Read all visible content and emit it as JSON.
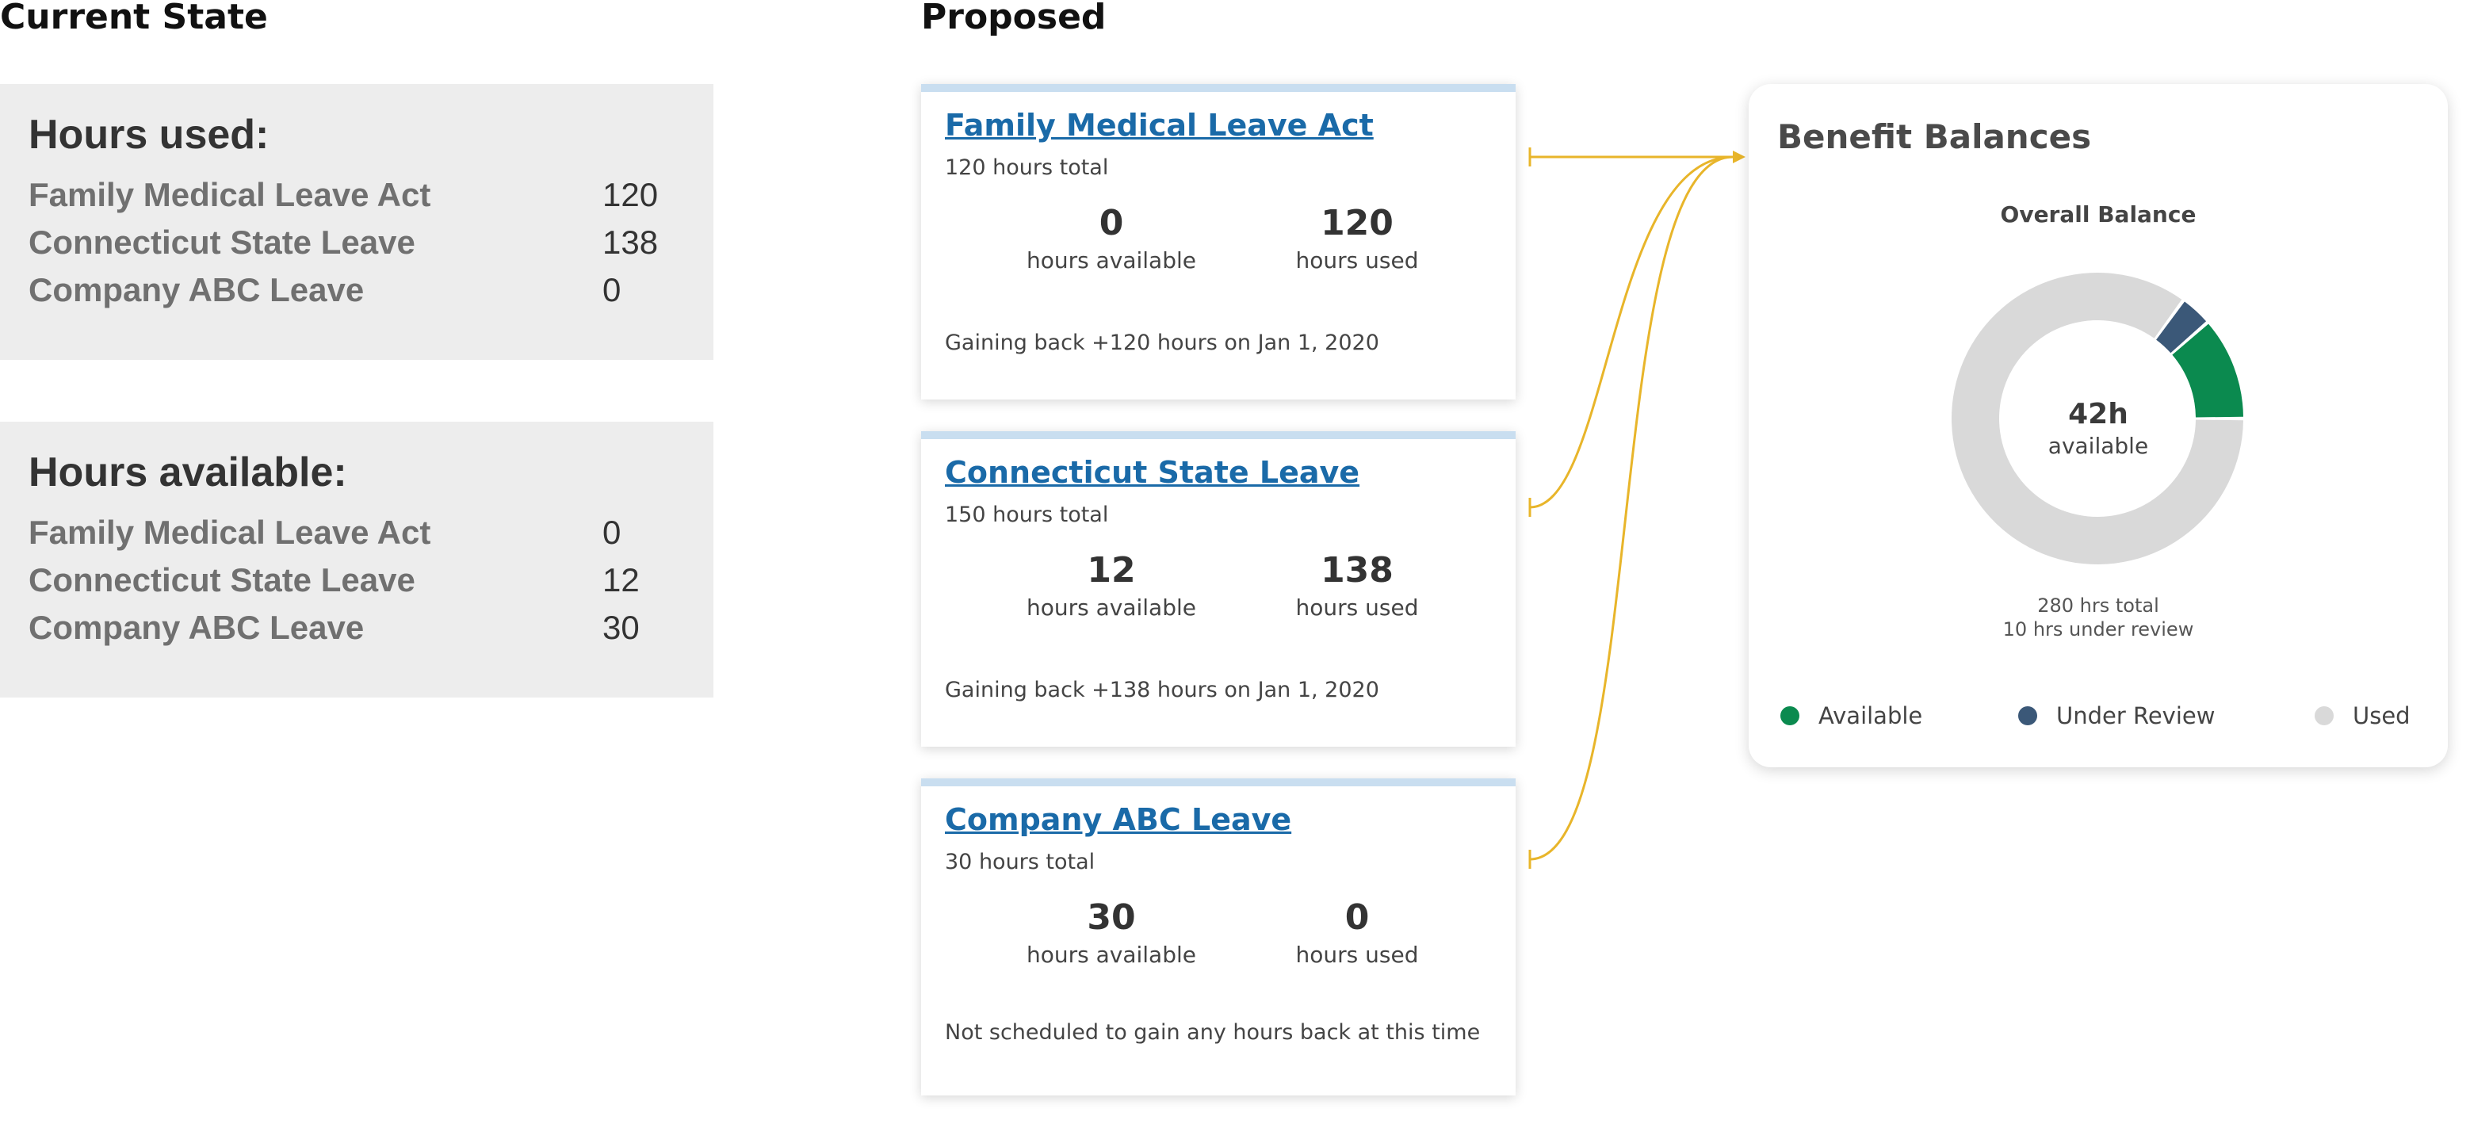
{
  "headers": {
    "current": "Current State",
    "proposed": "Proposed"
  },
  "hours_used": {
    "title": "Hours used:",
    "rows": [
      {
        "name": "Family Medical Leave Act",
        "value": "120"
      },
      {
        "name": "Connecticut State Leave",
        "value": "138"
      },
      {
        "name": "Company ABC Leave",
        "value": "0"
      }
    ]
  },
  "hours_available": {
    "title": "Hours available:",
    "rows": [
      {
        "name": "Family Medical Leave Act",
        "value": "0"
      },
      {
        "name": "Connecticut State Leave",
        "value": "12"
      },
      {
        "name": "Company ABC Leave",
        "value": "30"
      }
    ]
  },
  "cards": [
    {
      "title": "Family Medical Leave Act",
      "total": "120 hours total",
      "available": "0",
      "available_label": "hours available",
      "used": "120",
      "used_label": "hours used",
      "note": "Gaining back +120 hours on Jan 1, 2020"
    },
    {
      "title": "Connecticut State Leave",
      "total": "150 hours total",
      "available": "12",
      "available_label": "hours available",
      "used": "138",
      "used_label": "hours used",
      "note": "Gaining back +138 hours on Jan 1, 2020"
    },
    {
      "title": "Company ABC Leave",
      "total": "30 hours total",
      "available": "30",
      "available_label": "hours available",
      "used": "0",
      "used_label": "hours used",
      "note": "Not scheduled to gain any hours back at this time"
    }
  ],
  "balances": {
    "title": "Benefit Balances",
    "subtitle": "Overall Balance",
    "center_value": "42h",
    "center_label": "available",
    "total_text": "280 hrs total",
    "review_text": "10 hrs under review",
    "legend": [
      {
        "label": "Available",
        "color": "#0b8a4f"
      },
      {
        "label": "Under Review",
        "color": "#3b5878"
      },
      {
        "label": "Used",
        "color": "#d9d9d9"
      }
    ],
    "segments": [
      {
        "label": "Available",
        "value": 32,
        "color": "#0b8a4f"
      },
      {
        "label": "Under Review",
        "value": 10,
        "color": "#3b5878"
      },
      {
        "label": "Used",
        "value": 238,
        "color": "#d9d9d9"
      }
    ]
  },
  "connector_color": "#e8b52a"
}
